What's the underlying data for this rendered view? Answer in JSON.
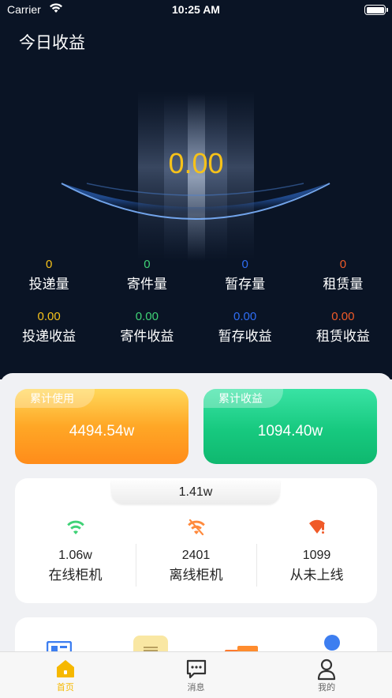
{
  "status_bar": {
    "carrier": "Carrier",
    "time": "10:25 AM"
  },
  "header": {
    "title": "今日收益"
  },
  "today": {
    "value": "0.00"
  },
  "colors": {
    "yellow": "#f6c21a",
    "green": "#3fd276",
    "blue": "#2f6df3",
    "red": "#f05a28"
  },
  "stats": {
    "counts": [
      {
        "value": "0",
        "label": "投递量",
        "color": "#f6c21a"
      },
      {
        "value": "0",
        "label": "寄件量",
        "color": "#3fd276"
      },
      {
        "value": "0",
        "label": "暂存量",
        "color": "#2f6df3"
      },
      {
        "value": "0",
        "label": "租赁量",
        "color": "#f05a28"
      }
    ],
    "revenues": [
      {
        "value": "0.00",
        "label": "投递收益",
        "color": "#f6c21a"
      },
      {
        "value": "0.00",
        "label": "寄件收益",
        "color": "#3fd276"
      },
      {
        "value": "0.00",
        "label": "暂存收益",
        "color": "#2f6df3"
      },
      {
        "value": "0.00",
        "label": "租赁收益",
        "color": "#f05a28"
      }
    ]
  },
  "summary": {
    "usage": {
      "tag": "累计使用",
      "value": "4494.54w"
    },
    "income": {
      "tag": "累计收益",
      "value": "1094.40w"
    }
  },
  "cabinets": {
    "total": "1.41w",
    "items": [
      {
        "value": "1.06w",
        "label": "在线柜机",
        "icon": "wifi-online-icon"
      },
      {
        "value": "2401",
        "label": "离线柜机",
        "icon": "wifi-offline-icon"
      },
      {
        "value": "1099",
        "label": "从未上线",
        "icon": "wifi-never-icon"
      }
    ]
  },
  "tabbar": {
    "items": [
      {
        "label": "首页",
        "icon": "home-icon",
        "active": true
      },
      {
        "label": "消息",
        "icon": "message-icon",
        "active": false
      },
      {
        "label": "我的",
        "icon": "profile-icon",
        "active": false
      }
    ]
  }
}
